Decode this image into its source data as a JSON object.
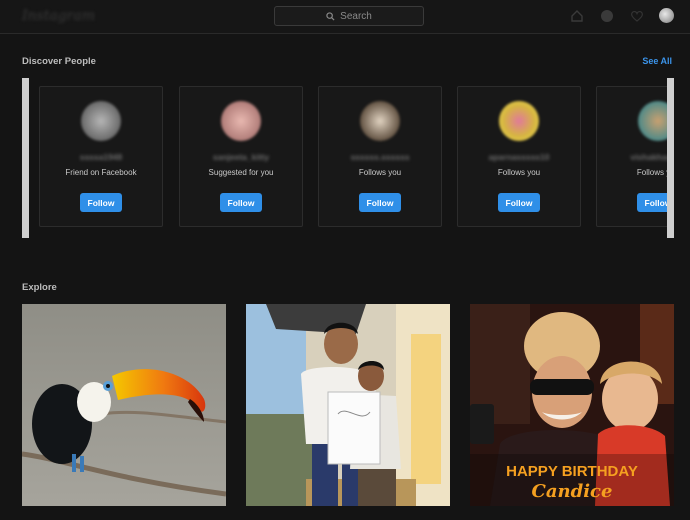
{
  "header": {
    "logo_text": "Instagram",
    "search_placeholder": "Search"
  },
  "discover": {
    "title": "Discover People",
    "see_all": "See All",
    "cards": [
      {
        "username": "ssssa1948",
        "reason": "Friend on Facebook",
        "follow_label": "Follow",
        "avatar_color": "#9a9a9a"
      },
      {
        "username": "sanjeeta_kitty",
        "reason": "Suggested for you",
        "follow_label": "Follow",
        "avatar_color": "#d9a3a0"
      },
      {
        "username": "ssssss.ssssss",
        "reason": "Follows you",
        "follow_label": "Follow",
        "avatar_color": "#8b7b6a"
      },
      {
        "username": "aparnasssss10",
        "reason": "Follows you",
        "follow_label": "Follow",
        "avatar_color": "#e8c840"
      },
      {
        "username": "vishakhassss",
        "reason": "Follows you",
        "follow_label": "Follow",
        "avatar_color": "#5f8f8a"
      }
    ]
  },
  "explore": {
    "title": "Explore",
    "tiles": [
      {
        "alt": "toucan on a branch"
      },
      {
        "alt": "man and boy holding a drawing"
      },
      {
        "alt": "woman and child selfie",
        "caption_line1": "HAPPY BIRTHDAY",
        "caption_line2": "Candice"
      }
    ]
  }
}
